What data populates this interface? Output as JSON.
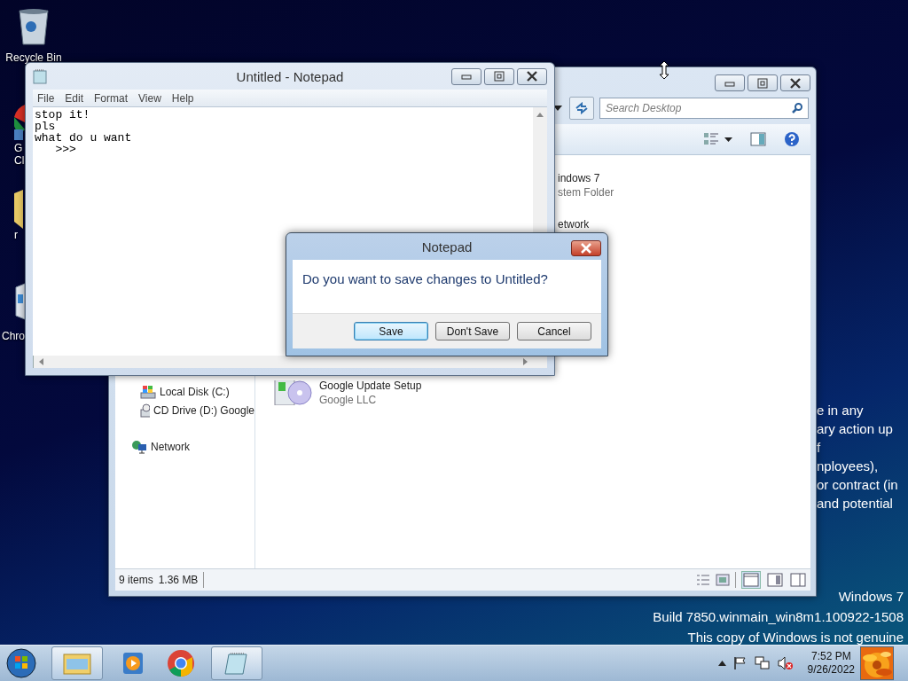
{
  "desktop": {
    "icons": [
      {
        "kind": "recycle",
        "lines": [
          "Recycle Bin"
        ]
      },
      {
        "kind": "chrome",
        "lines": [
          "G",
          "Cl"
        ]
      },
      {
        "kind": "folder",
        "lines": [
          "r"
        ]
      },
      {
        "kind": "installer",
        "lines": [
          "Chro"
        ]
      }
    ],
    "background_text": [
      "e in any",
      "ary action up",
      "f",
      "nployees),",
      "or contract (in",
      "and potential"
    ],
    "build_info": [
      "Windows 7",
      "Build 7850.winmain_win8m1.100922-1508",
      "This copy of Windows is not genuine"
    ]
  },
  "explorer": {
    "search": {
      "placeholder": "Search Desktop"
    },
    "nav": [
      {
        "kind": "disk",
        "label": "Local Disk (C:)"
      },
      {
        "kind": "cd",
        "label": "CD Drive (D:) Google"
      },
      {
        "kind": "network",
        "label": "Network"
      }
    ],
    "items": [
      {
        "kind": "partial",
        "name": "indows 7",
        "sub": "stem Folder"
      },
      {
        "kind": "partial",
        "name": "etwork"
      },
      {
        "kind": "setup",
        "name": "Google Update Setup",
        "sub": "Google LLC"
      }
    ],
    "status": [
      "9 items",
      "1.36 MB"
    ]
  },
  "notepad": {
    "title": "Untitled - Notepad",
    "menu": [
      "File",
      "Edit",
      "Format",
      "View",
      "Help"
    ],
    "text_lines": [
      "stop it!",
      "pls",
      "what do u want",
      "   >>>"
    ]
  },
  "dialog": {
    "title": "Notepad",
    "message": "Do you want to save changes to Untitled?",
    "buttons": [
      {
        "label": "Save",
        "default": true
      },
      {
        "label": "Don't Save",
        "default": false
      },
      {
        "label": "Cancel",
        "default": false
      }
    ]
  },
  "taskbar": {
    "items": [
      {
        "kind": "explorer",
        "open": true
      },
      {
        "kind": "media",
        "open": false
      },
      {
        "kind": "chrome",
        "open": false
      },
      {
        "kind": "notepad",
        "open": true
      }
    ],
    "time": "7:52 PM",
    "date": "9/26/2022"
  }
}
